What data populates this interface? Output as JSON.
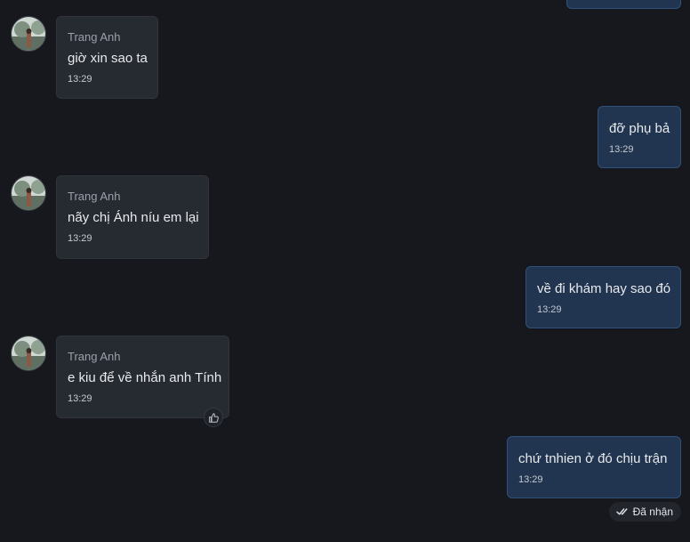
{
  "colors": {
    "background": "#16181d",
    "incoming_bubble": "#262a31",
    "outgoing_bubble": "#213450",
    "outgoing_border": "#30527a"
  },
  "messages": [
    {
      "direction": "in",
      "sender": "Trang Anh",
      "text": "giờ xin sao ta",
      "time": "13:29",
      "avatar": "avatar-image"
    },
    {
      "direction": "out",
      "text": "đỡ phụ bả",
      "time": "13:29"
    },
    {
      "direction": "in",
      "sender": "Trang Anh",
      "text": "nãy chị Ánh níu em lại",
      "time": "13:29",
      "avatar": "avatar-image"
    },
    {
      "direction": "out",
      "text": "về đi khám hay sao đó",
      "time": "13:29"
    },
    {
      "direction": "in",
      "sender": "Trang Anh",
      "text": "e kiu để về nhắn anh Tính",
      "time": "13:29",
      "avatar": "avatar-image",
      "reaction_button": "thumbs-up-icon"
    },
    {
      "direction": "out",
      "text": "chứ tnhien ở đó chịu trận",
      "time": "13:29"
    }
  ],
  "delivery_status": {
    "icon": "double-check-icon",
    "label": "Đã nhận"
  }
}
